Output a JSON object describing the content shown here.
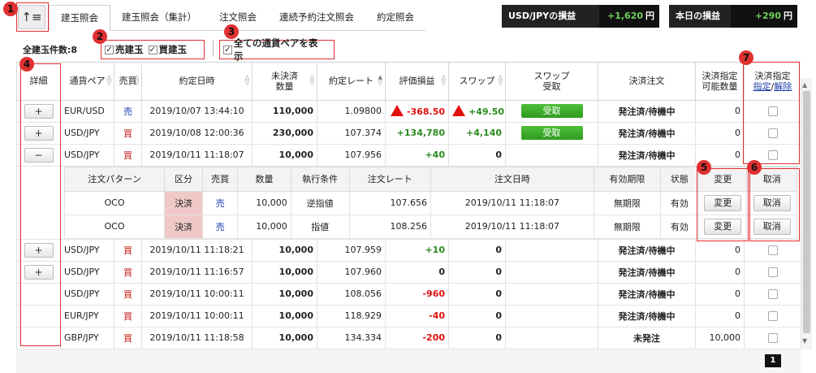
{
  "tabs": [
    "建玉照会",
    "建玉照会（集計）",
    "注文照会",
    "連続予約注文照会",
    "約定照会"
  ],
  "pnl": [
    {
      "label": "USD/JPYの損益",
      "value": "+1,620",
      "unit": "円"
    },
    {
      "label": "本日の損益",
      "value": "+290",
      "unit": "円"
    }
  ],
  "filter": {
    "count_label": "全建玉件数:8",
    "sell_label": "売建玉",
    "buy_label": "買建玉",
    "all_pairs_label": "全ての通貨ペアを表示"
  },
  "headers": {
    "detail": "詳細",
    "pair": "通貨ペア",
    "side": "売買",
    "datetime": "約定日時",
    "qty": "未決済\n数量",
    "rate": "約定レート",
    "pnl": "評価損益",
    "swap": "スワップ",
    "swap_recv": "スワップ\n受取",
    "settle": "決済注文",
    "settle_qty": "決済指定\n可能数量",
    "settle_spec": "決済指定",
    "spec_link": "指定",
    "release_link": "解除"
  },
  "rows_top": [
    {
      "btn": "+",
      "pair": "EUR/USD",
      "side": "売",
      "side_type": "sell",
      "datetime": "2019/10/07 13:44:10",
      "qty": "110,000",
      "rate": "1.09800",
      "pnl": "-368.50",
      "pnl_type": "neg",
      "pnl_tri": true,
      "swap": "+49.50",
      "swap_type": "pos",
      "swap_tri": true,
      "recv": "受取",
      "settle": "発注済/待機中",
      "settle_qty": "0"
    },
    {
      "btn": "+",
      "pair": "USD/JPY",
      "side": "買",
      "side_type": "buy",
      "datetime": "2019/10/08 12:00:36",
      "qty": "230,000",
      "rate": "107.374",
      "pnl": "+134,780",
      "pnl_type": "pos",
      "pnl_tri": false,
      "swap": "+4,140",
      "swap_type": "pos",
      "swap_tri": false,
      "recv": "受取",
      "settle": "発注済/待機中",
      "settle_qty": "0"
    },
    {
      "btn": "−",
      "pair": "USD/JPY",
      "side": "買",
      "side_type": "buy",
      "datetime": "2019/10/11 11:18:07",
      "qty": "10,000",
      "rate": "107.956",
      "pnl": "+40",
      "pnl_type": "pos",
      "pnl_tri": false,
      "swap": "0",
      "swap_type": "zero",
      "swap_tri": false,
      "recv": "",
      "settle": "発注済/待機中",
      "settle_qty": "0"
    }
  ],
  "sub": {
    "headers": [
      "注文パターン",
      "区分",
      "売買",
      "数量",
      "執行条件",
      "注文レート",
      "注文日時",
      "有効期限",
      "状態",
      "変更",
      "取消"
    ],
    "rows": [
      {
        "pattern": "OCO",
        "kubun": "決済",
        "side": "売",
        "qty": "10,000",
        "cond": "逆指値",
        "rate": "107.656",
        "datetime": "2019/10/11 11:18:07",
        "expiry": "無期限",
        "status": "有効",
        "change": "変更",
        "cancel": "取消"
      },
      {
        "pattern": "OCO",
        "kubun": "決済",
        "side": "売",
        "qty": "10,000",
        "cond": "指値",
        "rate": "108.256",
        "datetime": "2019/10/11 11:18:07",
        "expiry": "無期限",
        "status": "有効",
        "change": "変更",
        "cancel": "取消"
      }
    ]
  },
  "rows_bottom": [
    {
      "btn": "+",
      "pair": "USD/JPY",
      "side": "買",
      "side_type": "buy",
      "datetime": "2019/10/11 11:18:21",
      "qty": "10,000",
      "rate": "107.959",
      "pnl": "+10",
      "pnl_type": "pos",
      "swap": "0",
      "settle": "発注済/待機中",
      "settle_qty": "0"
    },
    {
      "btn": "+",
      "pair": "USD/JPY",
      "side": "買",
      "side_type": "buy",
      "datetime": "2019/10/11 11:16:57",
      "qty": "10,000",
      "rate": "107.960",
      "pnl": "0",
      "pnl_type": "zero",
      "swap": "0",
      "settle": "発注済/待機中",
      "settle_qty": "0"
    },
    {
      "btn": "",
      "pair": "USD/JPY",
      "side": "買",
      "side_type": "buy",
      "datetime": "2019/10/11 10:00:11",
      "qty": "10,000",
      "rate": "108.056",
      "pnl": "-960",
      "pnl_type": "neg",
      "swap": "0",
      "settle": "発注済/待機中",
      "settle_qty": "0"
    },
    {
      "btn": "",
      "pair": "EUR/JPY",
      "side": "買",
      "side_type": "buy",
      "datetime": "2019/10/11 10:00:11",
      "qty": "10,000",
      "rate": "118.929",
      "pnl": "-40",
      "pnl_type": "neg",
      "swap": "0",
      "settle": "発注済/待機中",
      "settle_qty": "0"
    },
    {
      "btn": "",
      "pair": "GBP/JPY",
      "side": "買",
      "side_type": "buy",
      "datetime": "2019/10/11 11:18:58",
      "qty": "10,000",
      "rate": "134.334",
      "pnl": "-200",
      "pnl_type": "neg",
      "swap": "0",
      "settle": "未発注",
      "settle_qty": "10,000"
    }
  ],
  "badges": [
    "1",
    "2",
    "3",
    "4",
    "5",
    "6",
    "7"
  ],
  "pagination": {
    "current": "1"
  },
  "icons": {
    "menu": "sort-list-icon",
    "scroll_up": "triangle-up-icon",
    "scroll_down": "triangle-down-icon"
  },
  "colors": {
    "annotation": "#e03030",
    "sell": "#1a3aa8",
    "buy": "#c31515",
    "positive": "#2a8a1e",
    "negative": "#e01010",
    "kubun_bg": "#f0c8c8"
  }
}
